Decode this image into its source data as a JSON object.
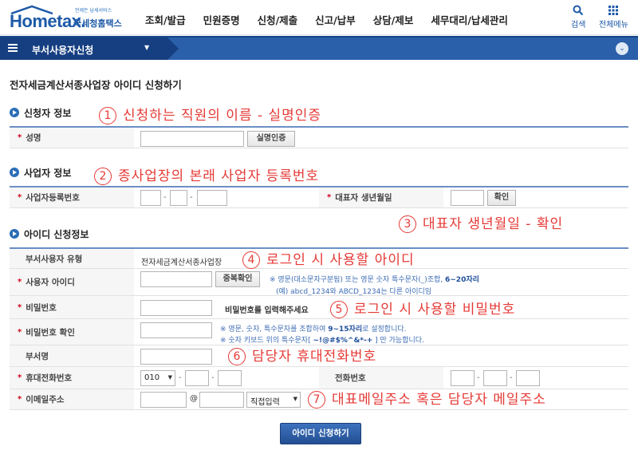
{
  "header": {
    "logo_en": "Hometax.",
    "logo_kr": "국세청홈택스",
    "logo_sub": "언제든 납세서비스",
    "menu": [
      "조회/발급",
      "민원증명",
      "신청/제출",
      "신고/납부",
      "상담/제보",
      "세무대리/납세관리"
    ],
    "search_label": "검색",
    "allmenu_label": "전체메뉴"
  },
  "location": {
    "label": "부서사용자신청"
  },
  "page_title": "전자세금계산서종사업장 아이디 신청하기",
  "sections": {
    "applicant": {
      "title": "신청자 정보"
    },
    "business": {
      "title": "사업자 정보"
    },
    "id_info": {
      "title": "아이디 신청정보"
    }
  },
  "form": {
    "name_label": "성명",
    "realname_btn": "실명인증",
    "bizno_label": "사업자등록번호",
    "rep_birth_label": "대표자 생년월일",
    "confirm_btn": "확인",
    "user_type_label": "부서사용자 유형",
    "user_type_value": "전자세금계산서종사업장",
    "user_id_label": "사용자 아이디",
    "dup_check_btn": "중복확인",
    "id_note1_pre": "※ 영문(대소문자구분됨) 또는 영문 숫자 특수문자(_)조합, ",
    "id_note1_bold": "6~20자리",
    "id_note2": "(예) abcd_1234와  ABCD_1234는 다른 아이디임",
    "pw_label": "비밀번호",
    "pw_prompt": "비밀번호를 입력해주세요",
    "pw_confirm_label": "비밀번호 확인",
    "pw_note1_pre": "※ 영문, 숫자, 특수문자를 조합하여 ",
    "pw_note1_bold": "9~15자리",
    "pw_note1_post": "로 설정합니다.",
    "pw_note2_pre": "※ 숫자 키보드 위의 특수문자[ ",
    "pw_note2_bold": "~!@#$%^&*-+",
    "pw_note2_post": " ] 만 가능합니다.",
    "dept_label": "부서명",
    "mobile_label": "휴대전화번호",
    "mobile_prefix": "010",
    "phone_label": "전화번호",
    "email_label": "이메일주소",
    "email_at": "@",
    "email_domain_select": "직접입력",
    "submit_btn": "아이디 신청하기"
  },
  "annotations": [
    {
      "num": "1",
      "text": "신청하는 직원의 이름 - 실명인증"
    },
    {
      "num": "2",
      "text": "종사업장의 본래 사업자 등록번호"
    },
    {
      "num": "3",
      "text": "대표자 생년월일 - 확인"
    },
    {
      "num": "4",
      "text": "로그인 시 사용할 아이디"
    },
    {
      "num": "5",
      "text": "로그인 시 사용할 비밀번호"
    },
    {
      "num": "6",
      "text": "담당자 휴대전화번호"
    },
    {
      "num": "7",
      "text": "대표메일주소 혹은 담당자 메일주소"
    }
  ]
}
